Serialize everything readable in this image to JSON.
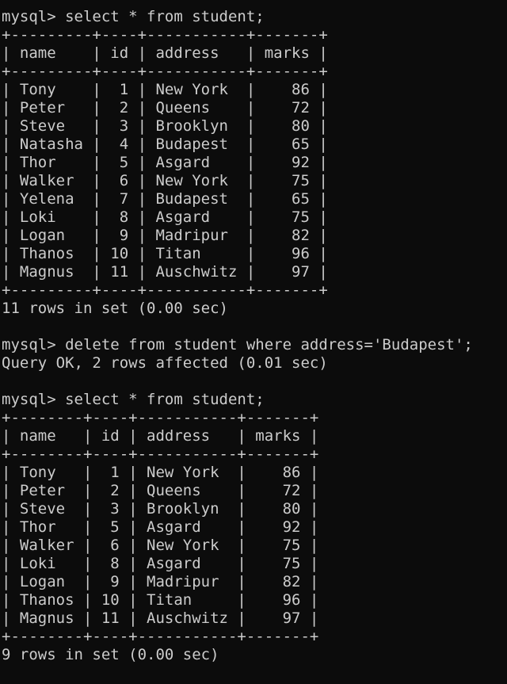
{
  "terminal": {
    "lines": [
      "mysql> select * from student;",
      "+---------+----+-----------+-------+",
      "| name    | id | address   | marks |",
      "+---------+----+-----------+-------+",
      "| Tony    |  1 | New York  |    86 |",
      "| Peter   |  2 | Queens    |    72 |",
      "| Steve   |  3 | Brooklyn  |    80 |",
      "| Natasha |  4 | Budapest  |    65 |",
      "| Thor    |  5 | Asgard    |    92 |",
      "| Walker  |  6 | New York  |    75 |",
      "| Yelena  |  7 | Budapest  |    65 |",
      "| Loki    |  8 | Asgard    |    75 |",
      "| Logan   |  9 | Madripur  |    82 |",
      "| Thanos  | 10 | Titan     |    96 |",
      "| Magnus  | 11 | Auschwitz |    97 |",
      "+---------+----+-----------+-------+",
      "11 rows in set (0.00 sec)",
      "",
      "mysql> delete from student where address='Budapest';",
      "Query OK, 2 rows affected (0.01 sec)",
      "",
      "mysql> select * from student;",
      "+--------+----+-----------+-------+",
      "| name   | id | address   | marks |",
      "+--------+----+-----------+-------+",
      "| Tony   |  1 | New York  |    86 |",
      "| Peter  |  2 | Queens    |    72 |",
      "| Steve  |  3 | Brooklyn  |    80 |",
      "| Thor   |  5 | Asgard    |    92 |",
      "| Walker |  6 | New York  |    75 |",
      "| Loki   |  8 | Asgard    |    75 |",
      "| Logan  |  9 | Madripur  |    82 |",
      "| Thanos | 10 | Titan     |    96 |",
      "| Magnus | 11 | Auschwitz |    97 |",
      "+--------+----+-----------+-------+",
      "9 rows in set (0.00 sec)"
    ]
  },
  "colors": {
    "background": "#0c0c0c",
    "text": "#cccccc"
  }
}
